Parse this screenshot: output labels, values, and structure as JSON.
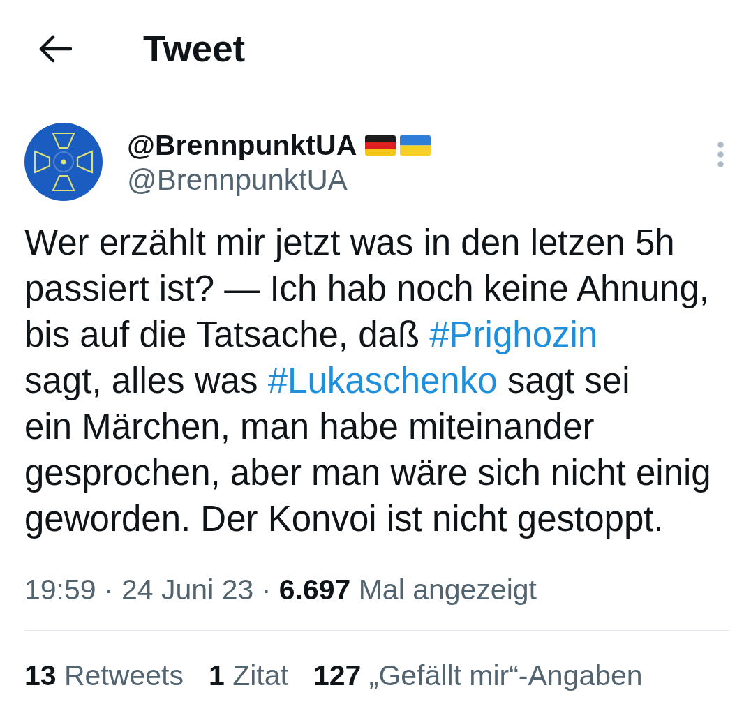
{
  "header": {
    "title": "Tweet"
  },
  "tweet": {
    "author": {
      "name": "@BrennpunktUA",
      "handle": "@BrennpunktUA"
    },
    "body": [
      {
        "kind": "text",
        "text": "Wer erzählt mir jetzt was in den letzen 5h\npassiert ist? — Ich hab noch keine Ahnung,\nbis auf die Tatsache, daß "
      },
      {
        "kind": "hashtag",
        "text": "#Prighozin"
      },
      {
        "kind": "text",
        "text": "\nsagt, alles was "
      },
      {
        "kind": "hashtag",
        "text": "#Lukaschenko"
      },
      {
        "kind": "text",
        "text": " sagt sei\nein Märchen, man habe miteinander\ngesprochen, aber man wäre sich nicht einig\ngeworden. Der Konvoi ist nicht gestoppt."
      }
    ],
    "meta": "19:59 · 24 Juni 23 · **6.697** Mal angezeigt",
    "stats": [
      {
        "count": "13",
        "label": "Retweets"
      },
      {
        "count": "1",
        "label": "Zitat"
      },
      {
        "count": "127",
        "label": "„Gefällt mir“-Angaben"
      }
    ]
  }
}
